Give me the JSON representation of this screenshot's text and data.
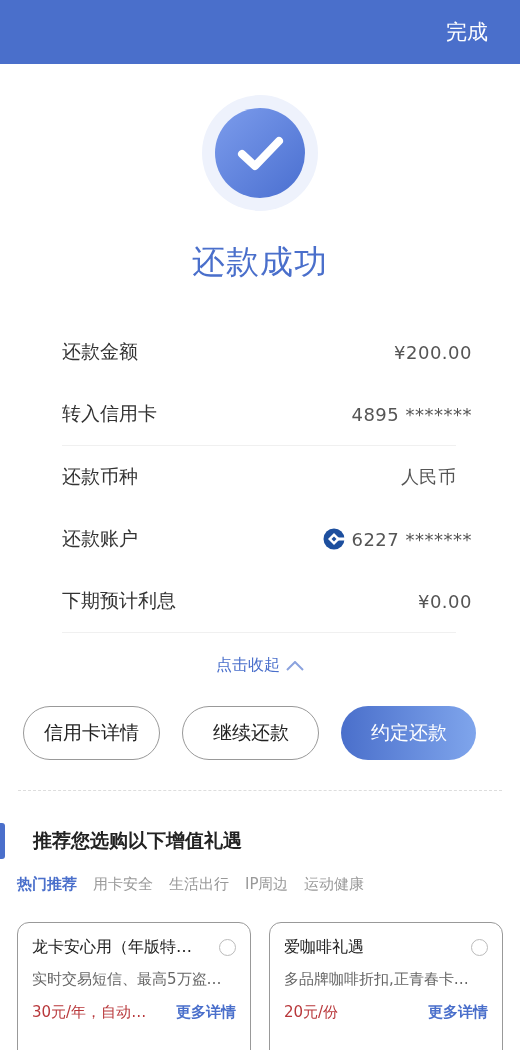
{
  "top_bar": {
    "done_button": "完成"
  },
  "result": {
    "title": "还款成功"
  },
  "details": [
    {
      "label": "还款金额",
      "value": "¥200.00",
      "kind": "text",
      "divider": false
    },
    {
      "label": "转入信用卡",
      "value": "4895 *******",
      "kind": "text",
      "divider": true
    },
    {
      "label": "还款币种",
      "value": "人民币",
      "kind": "text",
      "divider": false
    },
    {
      "label": "还款账户",
      "value": "6227 *******",
      "kind": "bank",
      "divider": false
    },
    {
      "label": "下期预计利息",
      "value": "¥0.00",
      "kind": "text",
      "divider": true
    }
  ],
  "collapse_link": "点击收起",
  "buttons": [
    {
      "label": "信用卡详情",
      "kind": "outline"
    },
    {
      "label": "继续还款",
      "kind": "outline"
    },
    {
      "label": "约定还款",
      "kind": "primary"
    }
  ],
  "recommend": {
    "title": "推荐您选购以下增值礼遇",
    "tabs": [
      {
        "label": "热门推荐",
        "selected": true
      },
      {
        "label": "用卡安全",
        "selected": false
      },
      {
        "label": "生活出行",
        "selected": false
      },
      {
        "label": "IP周边",
        "selected": false
      },
      {
        "label": "运动健康",
        "selected": false
      }
    ],
    "cards": [
      {
        "title": "龙卡安心用（年版特…",
        "desc": "实时交易短信、最高5万盗…",
        "price": "30元/年，自动…",
        "link": "更多详情",
        "checked": false
      },
      {
        "title": "爱咖啡礼遇",
        "desc": "多品牌咖啡折扣,正青春卡…",
        "price": "20元/份",
        "link": "更多详情",
        "checked": false
      }
    ]
  }
}
